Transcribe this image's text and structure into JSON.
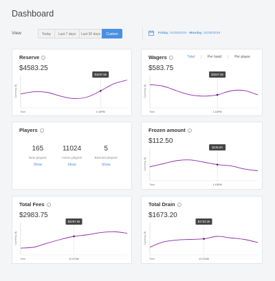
{
  "page": {
    "title": "Dashboard"
  },
  "filter": {
    "label": "View",
    "buttons": [
      "Today",
      "Last 7 days",
      "Last 30 days",
      "Custom"
    ],
    "active": "Custom",
    "date_from_day": "Friday",
    "date_from": "01/25/2019",
    "date_sep": " - ",
    "date_to_day": "Monday",
    "date_to": "02/25/2019"
  },
  "colors": {
    "accent": "#4a90e2",
    "line": "#8e24aa",
    "tooltip": "#444444"
  },
  "cards": {
    "reserve": {
      "title": "Reserve",
      "value": "$4583.25"
    },
    "wagers": {
      "title": "Wagers",
      "value": "$583.75",
      "tabs": [
        "Total",
        "Per hand",
        "Per player"
      ],
      "active_tab": "Total"
    },
    "players": {
      "title": "Players",
      "stats": [
        {
          "value": "165",
          "label": "New players",
          "action": "Show"
        },
        {
          "value": "11024",
          "label": "Active players",
          "action": "Show"
        },
        {
          "value": "5",
          "label": "Banned players",
          "action": "Show"
        }
      ]
    },
    "frozen": {
      "title": "Frozen amount",
      "value": "$112.50"
    },
    "fees": {
      "title": "Total Fees",
      "value": "$2983.75"
    },
    "drain": {
      "title": "Total Drain",
      "value": "$1673.20"
    }
  },
  "chart_data": [
    {
      "type": "line",
      "chart": "reserve",
      "xlabel": "Time",
      "ylabel": "Currency ($)",
      "x_marker": "1:15PM",
      "tooltip": "$3287.55",
      "y_normalized": [
        0.45,
        0.52,
        0.5,
        0.38,
        0.3,
        0.35,
        0.55,
        0.78,
        0.9
      ],
      "marker_index": 6
    },
    {
      "type": "line",
      "chart": "wagers",
      "xlabel": "Time",
      "ylabel": "Currency ($)",
      "x_marker": "1:15PM",
      "tooltip": "$3287.55",
      "y_normalized": [
        0.75,
        0.7,
        0.55,
        0.42,
        0.38,
        0.42,
        0.55,
        0.56,
        0.42
      ],
      "marker_index": 5
    },
    {
      "type": "line",
      "chart": "frozen",
      "xlabel": "Time",
      "ylabel": "Currency ($)",
      "x_marker": "1:15PM",
      "tooltip": "$135.00",
      "y_normalized": [
        0.45,
        0.55,
        0.65,
        0.67,
        0.6,
        0.52,
        0.48,
        0.38,
        0.32
      ],
      "marker_index": 5
    },
    {
      "type": "line",
      "chart": "fees",
      "xlabel": "Time",
      "ylabel": "Currency ($)",
      "x_marker": "11:37AM",
      "tooltip": "$3287.55",
      "y_normalized": [
        0.22,
        0.25,
        0.38,
        0.5,
        0.6,
        0.65,
        0.72,
        0.75,
        0.7
      ],
      "marker_index": 4
    },
    {
      "type": "line",
      "chart": "drain",
      "xlabel": "Time",
      "ylabel": "Currency ($)",
      "x_marker": "11:37AM",
      "tooltip": "$1733.25",
      "y_normalized": [
        0.25,
        0.42,
        0.48,
        0.5,
        0.52,
        0.6,
        0.55,
        0.5,
        0.4
      ],
      "marker_index": 4
    }
  ]
}
